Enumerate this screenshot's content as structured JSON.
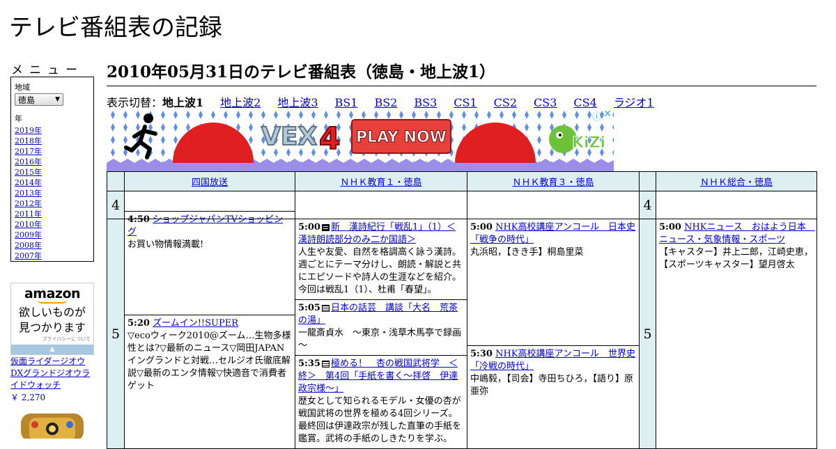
{
  "site": {
    "title": "テレビ番組表の記録"
  },
  "sidebar": {
    "menu_heading": "メニュー",
    "region_label": "地域",
    "region_value": "徳島",
    "year_label": "年",
    "years": [
      "2019年",
      "2018年",
      "2017年",
      "2016年",
      "2015年",
      "2014年",
      "2013年",
      "2012年",
      "2011年",
      "2010年",
      "2009年",
      "2008年",
      "2007年"
    ]
  },
  "amazon_ad": {
    "logo": "amazon",
    "text_line1": "欲しいものが",
    "text_line2": "見つかります",
    "privacy": "プライバシーについて",
    "product_name": "仮面ライダージオウ DXグランドジオウライドウォッチ",
    "product_price": "￥ 2,270"
  },
  "page": {
    "heading": "2010年05月31日のテレビ番組表（徳島・地上波1）",
    "switch_label": "表示切替：",
    "current_channel": "地上波1",
    "channel_links": [
      "地上波2",
      "地上波3",
      "BS1",
      "BS2",
      "BS3",
      "CS1",
      "CS2",
      "CS3",
      "CS4",
      "ラジオ1"
    ]
  },
  "game_ad": {
    "button": "PLAY NOW",
    "game_logo": "VEX4",
    "brand": "KiZi"
  },
  "schedule": {
    "hours": [
      "4",
      "5"
    ],
    "channels": [
      "四国放送",
      "ＮＨＫ教育１・徳島",
      "ＮＨＫ教育３・徳島",
      "ＮＨＫ総合・徳島"
    ],
    "ch1": [
      {
        "time": "4:50",
        "title": "ショップジャパンTVショッピング",
        "desc": "お買い物情報満載!"
      },
      {
        "time": "5:20",
        "title": "ズームイン!!SUPER",
        "desc": "▽ecoウィーク2010@ズーム…生物多様性とは?▽最新のニュース▽岡田JAPANイングランドと対戦…セルジオ氏徹底解説▽最新のエンタ情報▽快適音で消費者ゲット"
      }
    ],
    "ch2": [
      {
        "time": "5:00",
        "title": "新　漢詩紀行「戦乱1」（1）＜漢詩朗読部分のみ二か国語＞",
        "desc": "人生や友愛、自然を格調高く詠う漢詩。週ごとにテーマ分けし、朗読・解説と共にエピソードや詩人の生涯などを紹介。今回は戦乱1（1）、杜甫「春望」。"
      },
      {
        "time": "5:05",
        "title": "日本の話芸　講談「大名　荒茶の湯」",
        "desc": "一龍斎貞水　～東京・浅草木馬亭で録画～"
      },
      {
        "time": "5:35",
        "title": "極める！　杏の戦国武将学　＜終＞　第4回「手紙を書く～拝啓　伊達政宗様～」",
        "desc": "歴女として知られるモデル・女優の杏が戦国武将の世界を極める4回シリーズ。最終回は伊達政宗が残した直筆の手紙を鑑賞。武将の手紙のしきたりを学ぶ。"
      }
    ],
    "ch3": [
      {
        "time": "5:00",
        "title": "NHK高校講座アンコール　日本史「戦争の時代」",
        "desc": "丸浜昭，【きき手】桐島里菜"
      },
      {
        "time": "5:30",
        "title": "NHK高校講座アンコール　世界史「冷戦の時代」",
        "desc": "中嶋毅，【司会】寺田ちひろ，【語り】原亜弥"
      }
    ],
    "ch4": [
      {
        "time": "5:00",
        "title": "NHKニュース　おはよう日本　ニュース・気象情報・スポーツ",
        "desc": "【キャスター】井上二郎，江崎史恵，【スポーツキャスター】望月啓太"
      }
    ]
  },
  "colors": {
    "link": "#0000cc",
    "header_bg": "#ddeff0",
    "ad_banner_red": "#e02020",
    "ad_stripe": "#9a8ee8"
  }
}
